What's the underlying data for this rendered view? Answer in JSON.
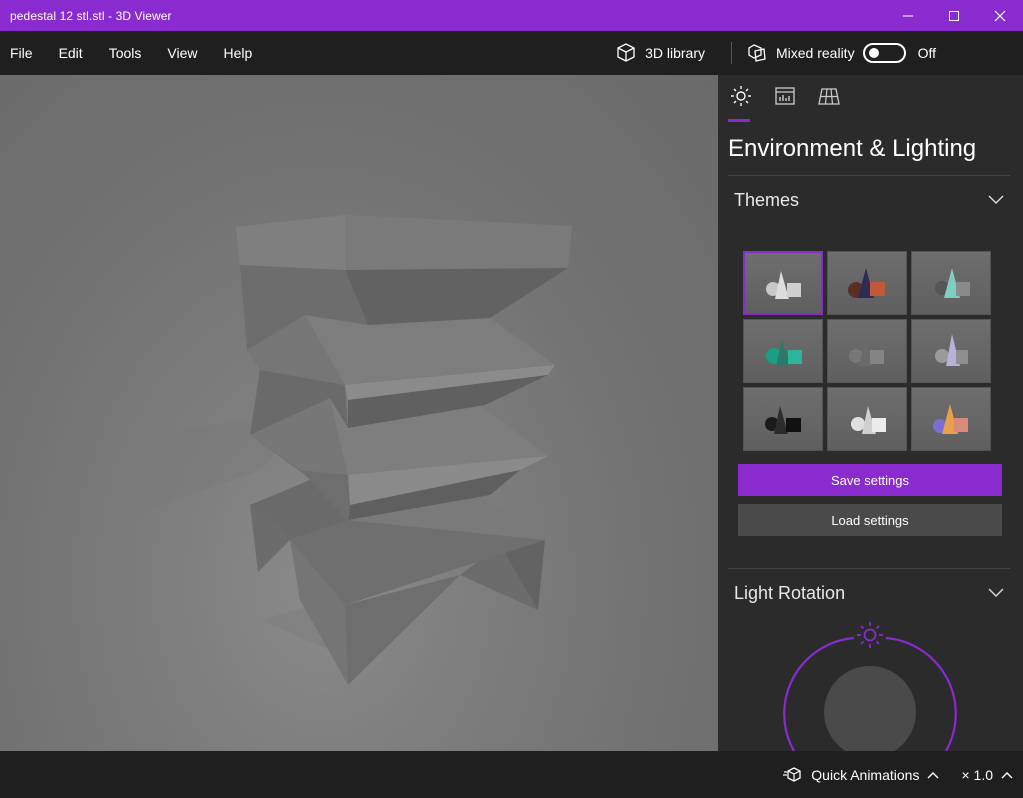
{
  "window": {
    "title": "pedestal 12 stl.stl - 3D Viewer"
  },
  "menu": {
    "items": [
      "File",
      "Edit",
      "Tools",
      "View",
      "Help"
    ],
    "library_label": "3D library",
    "mixed_reality_label": "Mixed reality",
    "mixed_reality_state": "Off"
  },
  "panel": {
    "title": "Environment & Lighting",
    "themes_label": "Themes",
    "save_label": "Save settings",
    "load_label": "Load settings",
    "light_rotation_label": "Light Rotation",
    "tabs": [
      "sun-icon",
      "chart-icon",
      "grid-icon"
    ],
    "theme_count": 9,
    "selected_theme": 1
  },
  "statusbar": {
    "quick_animations_label": "Quick Animations",
    "speed_label": "× 1.0"
  },
  "colors": {
    "accent": "#8a2bd0",
    "background": "#1f1f1f",
    "panel": "#2b2b2b"
  }
}
